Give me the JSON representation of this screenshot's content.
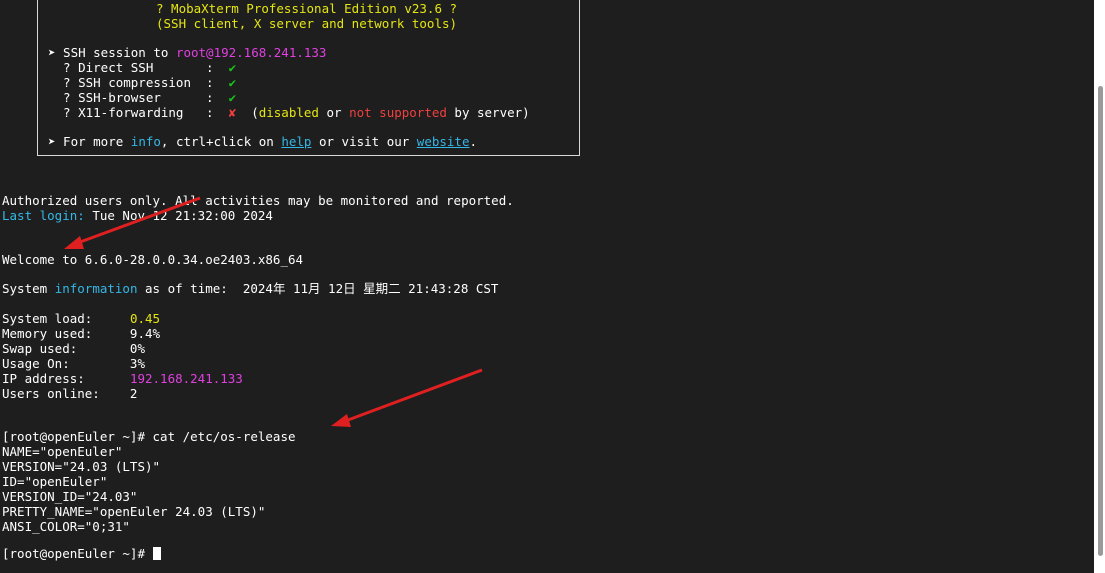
{
  "banner": {
    "edition": "? MobaXterm Professional Edition v23.6 ?",
    "subtitle": "(SSH client, X server and network tools)",
    "session_prefix": "➤ SSH session to ",
    "session_host": "root@192.168.241.133",
    "direct_ssh_label": "  ? Direct SSH       :  ",
    "ssh_compression_label": "  ? SSH compression  :  ",
    "ssh_browser_label": "  ? SSH-browser      :  ",
    "x11_label": "  ? X11-forwarding   :  ",
    "check": "✔",
    "cross": "✘",
    "x11_note_open": "  (",
    "disabled": "disabled",
    "or": " or ",
    "not_supported": "not supported",
    "by_server": " by server)",
    "more_prefix": "➤ For more ",
    "info": "info",
    "ctrl_click": ", ctrl+click on ",
    "help": "help",
    "visit": " or visit our ",
    "website": "website",
    "period": "."
  },
  "terminal": {
    "authorized": "Authorized users only. All activities may be monitored and reported.",
    "last_login_label": "Last login:",
    "last_login_value": " Tue Nov 12 21:32:00 2024",
    "welcome": "Welcome to 6.6.0-28.0.0.34.oe2403.x86_64",
    "sysinfo_prefix": "System ",
    "sysinfo_word": "information",
    "sysinfo_suffix": " as of time:  2024年 11月 12日 星期二 21:43:28 CST",
    "system_load_label": "System load:     ",
    "system_load_value": "0.45",
    "memory_used": "Memory used:     9.4%",
    "swap_used": "Swap used:       0%",
    "usage_on": "Usage On:        3%",
    "ip_label": "IP address:      ",
    "ip_value": "192.168.241.133",
    "users_online": "Users online:    2",
    "cmd1": "[root@openEuler ~]# cat /etc/os-release",
    "os_name": "NAME=\"openEuler\"",
    "os_version": "VERSION=\"24.03 (LTS)\"",
    "os_id": "ID=\"openEuler\"",
    "os_version_id": "VERSION_ID=\"24.03\"",
    "os_pretty": "PRETTY_NAME=\"openEuler 24.03 (LTS)\"",
    "os_ansi": "ANSI_COLOR=\"0;31\"",
    "prompt": "[root@openEuler ~]# "
  },
  "colors": {
    "background": "#1e1e1e",
    "annotation_arrow": "#e02020"
  }
}
